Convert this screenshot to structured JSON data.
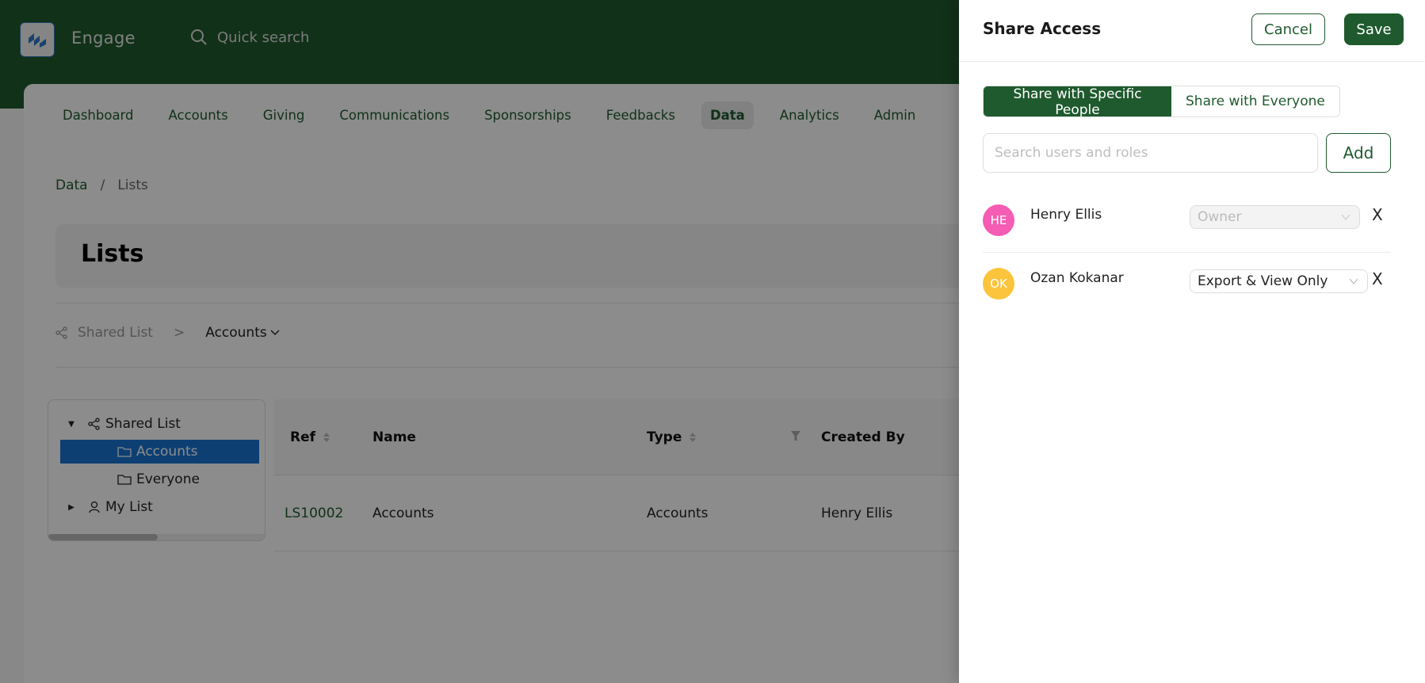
{
  "app": {
    "brand": "Engage",
    "quick_search_placeholder": "Quick search",
    "nav": [
      {
        "label": "Dashboard",
        "active": false
      },
      {
        "label": "Accounts",
        "active": false
      },
      {
        "label": "Giving",
        "active": false
      },
      {
        "label": "Communications",
        "active": false
      },
      {
        "label": "Sponsorships",
        "active": false
      },
      {
        "label": "Feedbacks",
        "active": false
      },
      {
        "label": "Data",
        "active": true
      },
      {
        "label": "Analytics",
        "active": false
      },
      {
        "label": "Admin",
        "active": false
      }
    ],
    "breadcrumb": [
      "Data",
      "Lists"
    ],
    "breadcrumb_sep": "/",
    "page_title": "Lists",
    "sub_breadcrumb": {
      "root": "Shared List",
      "sep": ">",
      "current": "Accounts"
    },
    "tree": {
      "items": [
        {
          "label": "Shared List",
          "icon": "share-icon",
          "caret": "expanded"
        },
        {
          "label": "Accounts",
          "icon": "folder-icon",
          "selected": true
        },
        {
          "label": "Everyone",
          "icon": "folder-icon"
        },
        {
          "label": "My List",
          "icon": "user-icon",
          "caret": "collapsed"
        }
      ]
    },
    "table": {
      "columns": [
        "Ref",
        "Name",
        "Type",
        "Created By"
      ],
      "rows": [
        {
          "ref": "LS10002",
          "name": "Accounts",
          "type": "Accounts",
          "created_by": "Henry Ellis"
        }
      ]
    }
  },
  "drawer": {
    "title": "Share Access",
    "cancel_label": "Cancel",
    "save_label": "Save",
    "segments": [
      {
        "label": "Share with Specific People",
        "active": true
      },
      {
        "label": "Share with Everyone",
        "active": false
      }
    ],
    "search_placeholder": "Search users and roles",
    "search_value": "",
    "add_label": "Add",
    "users": [
      {
        "initials": "HE",
        "name": "Henry Ellis",
        "role": "Owner",
        "role_disabled": true,
        "avatar_color": "#f55cb3"
      },
      {
        "initials": "OK",
        "name": "Ozan Kokanar",
        "role": "Export & View Only",
        "role_disabled": false,
        "avatar_color": "#fbc43c"
      }
    ],
    "remove_icon": "X"
  },
  "colors": {
    "brand_green": "#1f5a2e",
    "selection_blue": "#1874d2"
  }
}
